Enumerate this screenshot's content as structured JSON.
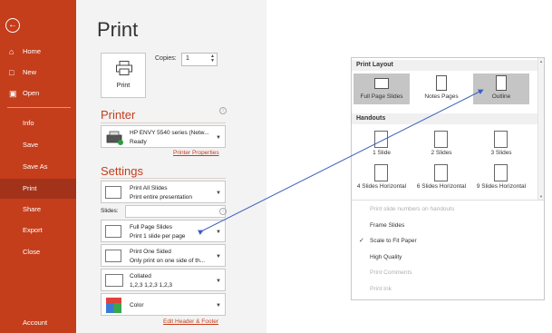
{
  "nav": {
    "items": [
      {
        "label": "Home",
        "icon": "home-icon"
      },
      {
        "label": "New",
        "icon": "new-icon"
      },
      {
        "label": "Open",
        "icon": "open-folder-icon"
      },
      {
        "label": "Info"
      },
      {
        "label": "Save"
      },
      {
        "label": "Save As"
      },
      {
        "label": "Print"
      },
      {
        "label": "Share"
      },
      {
        "label": "Export"
      },
      {
        "label": "Close"
      },
      {
        "label": "Account"
      }
    ],
    "accent": "#c43e1c"
  },
  "print": {
    "title": "Print",
    "button_label": "Print",
    "copies_label": "Copies:",
    "copies_value": "1"
  },
  "printer": {
    "heading": "Printer",
    "name": "HP ENVY 5540 series (Netw...",
    "status": "Ready",
    "properties_link": "Printer Properties"
  },
  "settings": {
    "heading": "Settings",
    "range": {
      "line1": "Print All Slides",
      "line2": "Print entire presentation"
    },
    "slides_label": "Slides:",
    "layout": {
      "line1": "Full Page Slides",
      "line2": "Print 1 slide per page"
    },
    "sides": {
      "line1": "Print One Sided",
      "line2": "Only print on one side of th..."
    },
    "collation": {
      "line1": "Collated",
      "line2": "1,2,3    1,2,3    1,2,3"
    },
    "color": {
      "line1": "Color"
    },
    "footer_link": "Edit Header & Footer"
  },
  "popup": {
    "layout_heading": "Print Layout",
    "layouts": [
      "Full Page Slides",
      "Notes Pages",
      "Outline"
    ],
    "handouts_heading": "Handouts",
    "handouts": [
      "1 Slide",
      "2 Slides",
      "3 Slides",
      "4 Slides Horizontal",
      "6 Slides Horizontal",
      "9 Slides Horizontal"
    ],
    "options": [
      {
        "label": "Print slide numbers on handouts",
        "enabled": false,
        "checked": false
      },
      {
        "label": "Frame Slides",
        "enabled": true,
        "checked": false
      },
      {
        "label": "Scale to Fit Paper",
        "enabled": true,
        "checked": true
      },
      {
        "label": "High Quality",
        "enabled": true,
        "checked": false
      },
      {
        "label": "Print Comments",
        "enabled": false,
        "checked": false
      },
      {
        "label": "Print Ink",
        "enabled": false,
        "checked": false
      }
    ]
  }
}
